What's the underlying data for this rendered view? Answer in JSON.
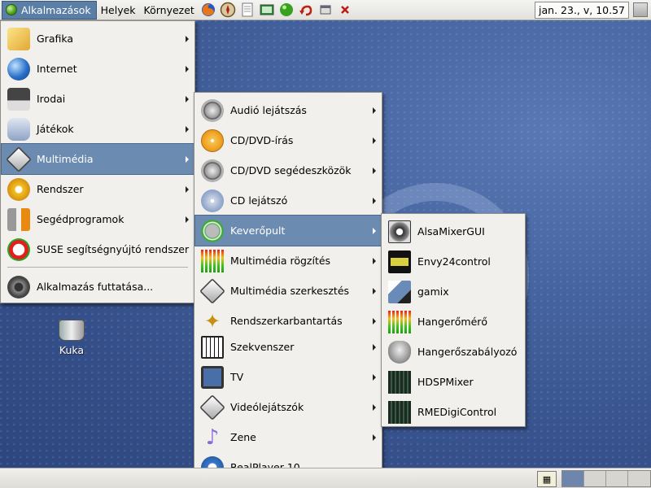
{
  "top_panel": {
    "app_menu": "Alkalmazások",
    "menus": [
      "Helyek",
      "Környezet"
    ],
    "clock": "jan. 23., v, 10.57"
  },
  "desktop": {
    "icons": [
      {
        "label": "Kuka",
        "icon": "trash-icon"
      }
    ]
  },
  "main_menu": {
    "items": [
      {
        "label": "Grafika",
        "icon": "graphics-icon",
        "submenu": true
      },
      {
        "label": "Internet",
        "icon": "globe-icon",
        "submenu": true
      },
      {
        "label": "Irodai",
        "icon": "typewriter-icon",
        "submenu": true
      },
      {
        "label": "Játékok",
        "icon": "gamepad-icon",
        "submenu": true
      },
      {
        "label": "Multimédia",
        "icon": "multimedia-icon",
        "submenu": true,
        "selected": true
      },
      {
        "label": "Rendszer",
        "icon": "system-gears-icon",
        "submenu": true
      },
      {
        "label": "Segédprogramok",
        "icon": "tools-icon",
        "submenu": true
      },
      {
        "label": "SUSE segítségnyújtó rendszer",
        "icon": "help-lifebuoy-icon",
        "submenu": false
      }
    ],
    "run_app": "Alkalmazás futtatása..."
  },
  "multimedia_menu": {
    "items": [
      {
        "label": "Audió lejátszás",
        "submenu": true
      },
      {
        "label": "CD/DVD-írás",
        "submenu": true
      },
      {
        "label": "CD/DVD segédeszközök",
        "submenu": true
      },
      {
        "label": "CD lejátszó",
        "submenu": true
      },
      {
        "label": "Keverőpult",
        "submenu": true,
        "selected": true
      },
      {
        "label": "Multimédia rögzítés",
        "submenu": true
      },
      {
        "label": "Multimédia szerkesztés",
        "submenu": true
      },
      {
        "label": "Rendszerkarbantartás",
        "submenu": true
      },
      {
        "label": "Szekvenszer",
        "submenu": true
      },
      {
        "label": "TV",
        "submenu": true
      },
      {
        "label": "Videólejátszók",
        "submenu": true
      },
      {
        "label": "Zene",
        "submenu": true
      },
      {
        "label": "RealPlayer 10",
        "submenu": false
      }
    ]
  },
  "mixer_menu": {
    "items": [
      {
        "label": "AlsaMixerGUI"
      },
      {
        "label": "Envy24control"
      },
      {
        "label": "gamix"
      },
      {
        "label": "Hangerőmérő"
      },
      {
        "label": "Hangerőszabályozó"
      },
      {
        "label": "HDSPMixer"
      },
      {
        "label": "RMEDigiControl"
      }
    ]
  },
  "bottom_panel": {
    "workspaces": 4,
    "active_workspace": 1
  }
}
